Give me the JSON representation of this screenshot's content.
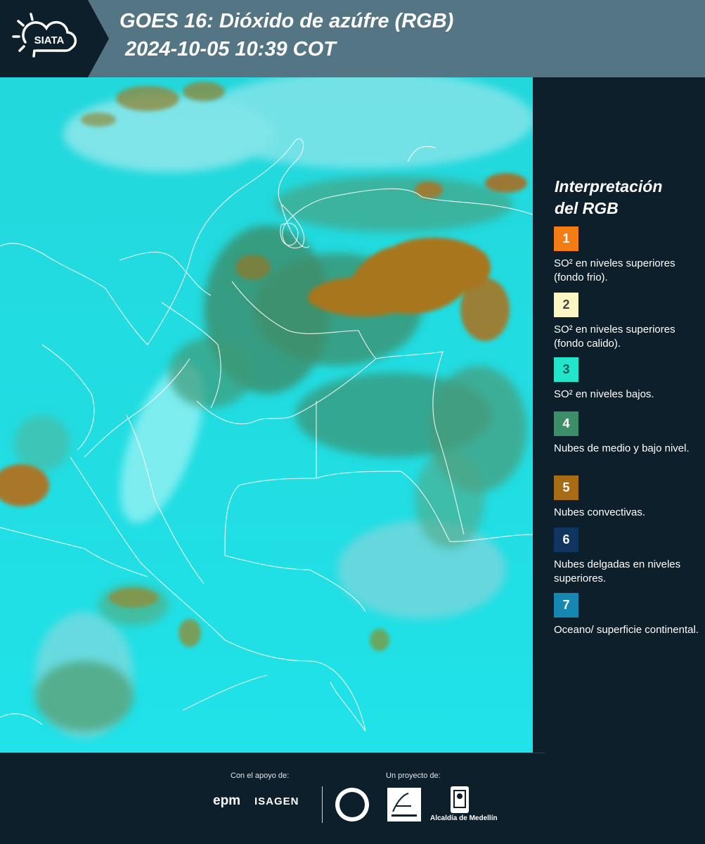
{
  "header": {
    "logo_text": "SIATA",
    "title_line1": "GOES 16: Dióxido de azúfre (RGB)",
    "title_line2": "2024-10-05 10:39 COT"
  },
  "legend": {
    "title_line1": "Interpretación",
    "title_line2": "del RGB",
    "items": [
      {
        "number": "1",
        "color": "#f47c14",
        "number_color": "#ffffff",
        "text": "SO² en niveles superiores (fondo frio)."
      },
      {
        "number": "2",
        "color": "#fbf6c4",
        "number_color": "#444444",
        "text": "SO² en niveles superiores (fondo calido)."
      },
      {
        "number": "3",
        "color": "#22e6cb",
        "number_color": "#2a5a58",
        "text": "SO² en niveles bajos."
      },
      {
        "number": "4",
        "color": "#3d8d68",
        "number_color": "#ffffff",
        "text": "Nubes de medio y bajo nivel."
      },
      {
        "number": "5",
        "color": "#a86c14",
        "number_color": "#ffffff",
        "text": "Nubes convectivas."
      },
      {
        "number": "6",
        "color": "#0f3560",
        "number_color": "#ffffff",
        "text": "Nubes delgadas en niveles superiores."
      },
      {
        "number": "7",
        "color": "#1686b3",
        "number_color": "#ffffff",
        "text": "Oceano/ superficie continental."
      }
    ]
  },
  "footer": {
    "support_label": "Con el apoyo de:",
    "project_label": "Un proyecto de:",
    "sponsor1": "epm",
    "sponsor2": "ISAGEN",
    "partner3": "Alcaldía de Medellín"
  }
}
